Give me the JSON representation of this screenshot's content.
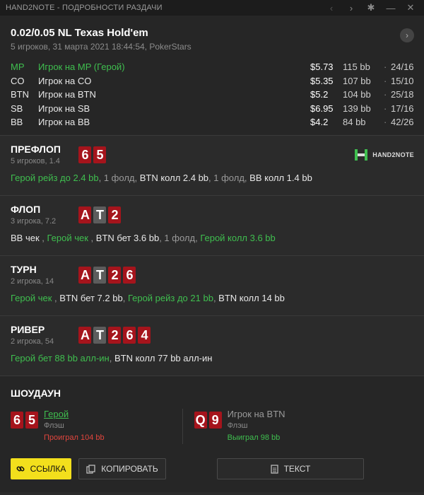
{
  "app": {
    "title": "HAND2NOTE - ПОДРОБНОСТИ РАЗДАЧИ",
    "controls": {
      "prev": "‹",
      "next": "›",
      "settings": "✱",
      "minimize": "—",
      "close": "✕"
    }
  },
  "hand": {
    "title": "0.02/0.05 NL Texas Hold'em",
    "subtitle": "5 игроков, 31 марта 2021 18:44:54, PokerStars",
    "next_icon": "›",
    "players": [
      {
        "pos": "MP",
        "name": "Игрок на MP (Герой)",
        "stack": "$5.73",
        "bb": "115 bb",
        "hud": "24/16",
        "hero": true
      },
      {
        "pos": "CO",
        "name": "Игрок на CO",
        "stack": "$5.35",
        "bb": "107 bb",
        "hud": "15/10",
        "hero": false
      },
      {
        "pos": "BTN",
        "name": "Игрок на BTN",
        "stack": "$5.2",
        "bb": "104 bb",
        "hud": "25/18",
        "hero": false
      },
      {
        "pos": "SB",
        "name": "Игрок на SB",
        "stack": "$6.95",
        "bb": "139 bb",
        "hud": "17/16",
        "hero": false
      },
      {
        "pos": "BB",
        "name": "Игрок на BB",
        "stack": "$4.2",
        "bb": "84 bb",
        "hud": "42/26",
        "hero": false
      }
    ],
    "dot": "·"
  },
  "logo": {
    "text": "HAND2NOTE"
  },
  "streets": {
    "preflop": {
      "name": "ПРЕФЛОП",
      "sub": "5 игроков, 1.4",
      "cards": [
        "6",
        "5"
      ],
      "actions": [
        {
          "t": "Герой рейз до 2.4 bb",
          "c": "green"
        },
        {
          "t": ", 1 фолд, ",
          "c": "muted"
        },
        {
          "t": "BTN колл 2.4 bb",
          "c": "white"
        },
        {
          "t": ", 1 фолд, ",
          "c": "muted"
        },
        {
          "t": "BB колл 1.4 bb",
          "c": "white"
        }
      ]
    },
    "flop": {
      "name": "ФЛОП",
      "sub": "3 игрока, 7.2",
      "cards": [
        "A",
        "T",
        "2"
      ],
      "actions": [
        {
          "t": "BB чек",
          "c": "white"
        },
        {
          "t": " , ",
          "c": "muted"
        },
        {
          "t": "Герой чек",
          "c": "green"
        },
        {
          "t": " , ",
          "c": "muted"
        },
        {
          "t": "BTN бет 3.6 bb",
          "c": "white"
        },
        {
          "t": ", 1 фолд, ",
          "c": "muted"
        },
        {
          "t": "Герой колл 3.6 bb",
          "c": "green"
        }
      ]
    },
    "turn": {
      "name": "ТУРН",
      "sub": "2 игрока, 14",
      "cards": [
        "A",
        "T",
        "2",
        "6"
      ],
      "actions": [
        {
          "t": "Герой чек",
          "c": "green"
        },
        {
          "t": " , ",
          "c": "muted"
        },
        {
          "t": "BTN бет 7.2 bb",
          "c": "white"
        },
        {
          "t": ", ",
          "c": "muted"
        },
        {
          "t": "Герой рейз до 21 bb",
          "c": "green"
        },
        {
          "t": ", ",
          "c": "muted"
        },
        {
          "t": "BTN колл 14 bb",
          "c": "white"
        }
      ]
    },
    "river": {
      "name": "РИВЕР",
      "sub": "2 игрока, 54",
      "cards": [
        "A",
        "T",
        "2",
        "6",
        "4"
      ],
      "actions": [
        {
          "t": "Герой бет 88 bb алл-ин",
          "c": "green"
        },
        {
          "t": ", ",
          "c": "muted"
        },
        {
          "t": "BTN колл 77 bb алл-ин",
          "c": "white"
        }
      ]
    }
  },
  "showdown": {
    "title": "ШОУДАУН",
    "hero": {
      "cards": [
        "6",
        "5"
      ],
      "name": "Герой",
      "hand": "Флэш",
      "result": "Проиграл 104 bb"
    },
    "villain": {
      "cards": [
        "Q",
        "9"
      ],
      "name": "Игрок на BTN",
      "hand": "Флэш",
      "result": "Выиграл 98 bb"
    }
  },
  "buttons": {
    "link": "ССЫЛКА",
    "copy": "КОПИРОВАТЬ",
    "text": "ТЕКСТ"
  },
  "card_colors": {
    "red": "#a5141c",
    "grey": "#5c5c5c"
  }
}
